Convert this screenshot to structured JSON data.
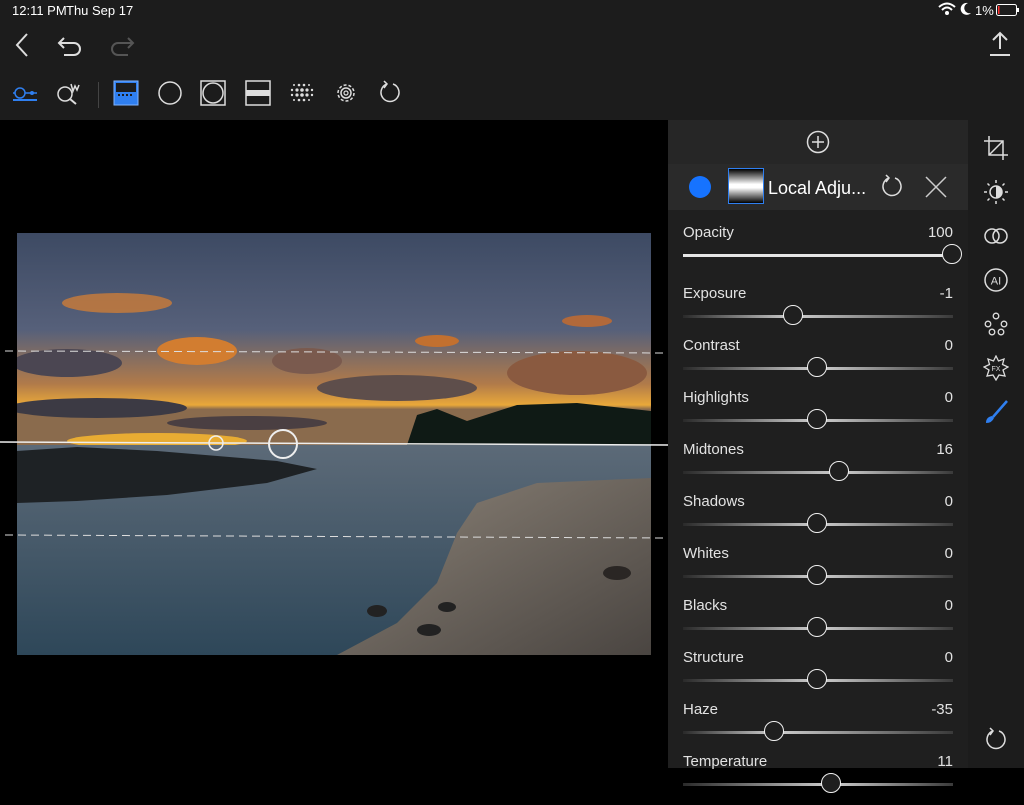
{
  "status": {
    "time": "12:11 PM",
    "date": "Thu Sep 17",
    "battery": "1%"
  },
  "nav": {
    "back_icon": "chevron-left-icon",
    "undo_icon": "undo-icon",
    "redo_icon": "redo-icon",
    "share_icon": "share-icon"
  },
  "toolbar": {
    "tools": [
      "mask-slider-icon",
      "magic-brush-icon",
      "gradient-mask-icon",
      "radial-mask-icon",
      "vignette-mask-icon",
      "linear-mask-icon",
      "dots-mask-icon",
      "settings-icon",
      "reset-icon"
    ],
    "active": "gradient-mask-icon",
    "accent": "#2f7ff0"
  },
  "panel": {
    "add_icon": "plus-circle-icon",
    "layer": {
      "name": "Local Adju...",
      "color": "#1673ff"
    },
    "sliders": [
      {
        "label": "Opacity",
        "value": "100",
        "pos": 1.0
      },
      {
        "label": "Exposure",
        "value": "-1",
        "pos": 0.41
      },
      {
        "label": "Contrast",
        "value": "0",
        "pos": 0.5
      },
      {
        "label": "Highlights",
        "value": "0",
        "pos": 0.5
      },
      {
        "label": "Midtones",
        "value": "16",
        "pos": 0.58
      },
      {
        "label": "Shadows",
        "value": "0",
        "pos": 0.5
      },
      {
        "label": "Whites",
        "value": "0",
        "pos": 0.5
      },
      {
        "label": "Blacks",
        "value": "0",
        "pos": 0.5
      },
      {
        "label": "Structure",
        "value": "0",
        "pos": 0.5
      },
      {
        "label": "Haze",
        "value": "-35",
        "pos": 0.34
      },
      {
        "label": "Temperature",
        "value": "11",
        "pos": 0.55
      }
    ]
  },
  "side_tools": [
    "crop-icon",
    "light-icon",
    "color-icon",
    "ai-icon",
    "details-icon",
    "effects-icon",
    "brush-icon",
    "reset-icon"
  ],
  "side_active": "brush-icon"
}
